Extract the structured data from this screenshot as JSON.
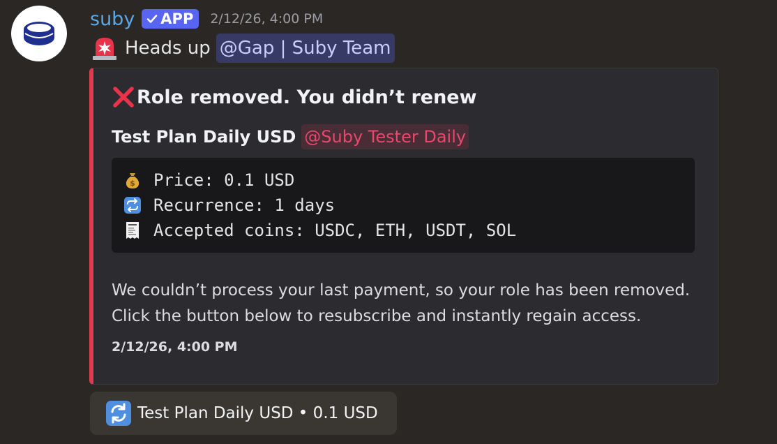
{
  "author": {
    "name": "suby",
    "badge": "APP",
    "timestamp": "2/12/26, 4:00 PM"
  },
  "message": {
    "text": "Heads up",
    "mention": "@Gap | Suby Team"
  },
  "embed": {
    "accent_color": "#e03a4e",
    "title": "Role removed. You didn’t renew",
    "plan_name": "Test Plan Daily USD",
    "role_mention": "@Suby Tester Daily",
    "code_lines": [
      {
        "icon": "money-bag-icon",
        "text": "Price: 0.1 USD"
      },
      {
        "icon": "repeat-icon",
        "text": "Recurrence: 1 days"
      },
      {
        "icon": "receipt-icon",
        "text": "Accepted coins: USDC, ETH, USDT, SOL"
      }
    ],
    "description_line1": "We couldn’t process your last payment, so your role has been removed.",
    "description_line2": "Click the button below to resubscribe and instantly regain access.",
    "footer_timestamp": "2/12/26, 4:00 PM"
  },
  "button": {
    "icon": "refresh-icon",
    "label": "Test Plan Daily USD • 0.1 USD"
  },
  "colors": {
    "background": "#2a2724",
    "username": "#5aa7e8",
    "app_badge": "#5865f2",
    "role_mention": "#e9476c"
  }
}
